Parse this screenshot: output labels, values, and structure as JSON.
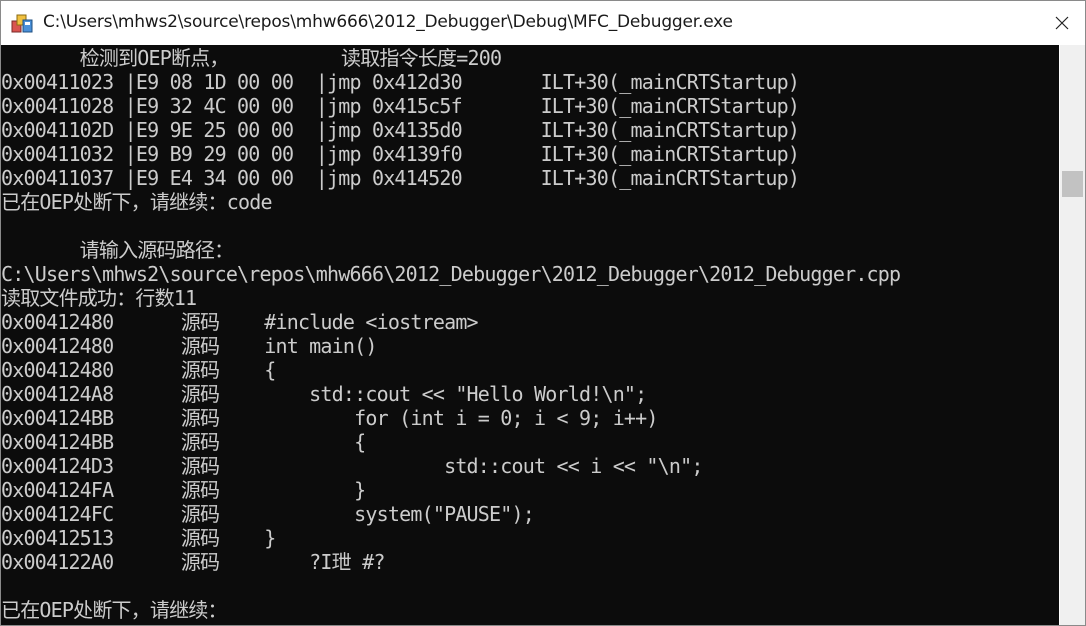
{
  "window": {
    "title": "C:\\Users\\mhws2\\source\\repos\\mhw666\\2012_Debugger\\Debug\\MFC_Debugger.exe",
    "app_icon": "console-app-icon",
    "close_icon": "close-icon"
  },
  "console": {
    "lines": [
      "       检测到OEP断点，          读取指令长度=200",
      "0x00411023 |E9 08 1D 00 00  |jmp 0x412d30       ILT+30(_mainCRTStartup)",
      "0x00411028 |E9 32 4C 00 00  |jmp 0x415c5f       ILT+30(_mainCRTStartup)",
      "0x0041102D |E9 9E 25 00 00  |jmp 0x4135d0       ILT+30(_mainCRTStartup)",
      "0x00411032 |E9 B9 29 00 00  |jmp 0x4139f0       ILT+30(_mainCRTStartup)",
      "0x00411037 |E9 E4 34 00 00  |jmp 0x414520       ILT+30(_mainCRTStartup)",
      "已在OEP处断下，请继续：code",
      "",
      "       请输入源码路径：",
      "C:\\Users\\mhws2\\source\\repos\\mhw666\\2012_Debugger\\2012_Debugger\\2012_Debugger.cpp",
      "读取文件成功：行数11",
      "0x00412480      源码    #include <iostream>",
      "0x00412480      源码    int main()",
      "0x00412480      源码    {",
      "0x004124A8      源码        std::cout << \"Hello World!\\n\";",
      "0x004124BB      源码            for (int i = 0; i < 9; i++)",
      "0x004124BB      源码            {",
      "0x004124D3      源码                    std::cout << i << \"\\n\";",
      "0x004124FA      源码            }",
      "0x004124FC      源码            system(\"PAUSE\");",
      "0x00412513      源码    }",
      "0x004122A0      源码        ?I玴 #?",
      "",
      "已在OEP处断下，请继续："
    ]
  }
}
